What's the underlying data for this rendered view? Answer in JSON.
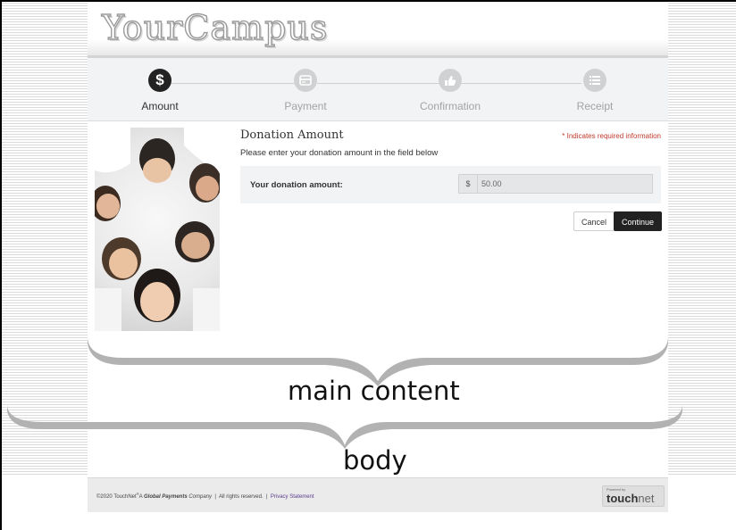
{
  "brand": {
    "logo_text": "YourCampus"
  },
  "steps": [
    {
      "label": "Amount",
      "icon": "dollar-icon",
      "symbol": "$"
    },
    {
      "label": "Payment",
      "icon": "card-icon"
    },
    {
      "label": "Confirmation",
      "icon": "thumbs-up-icon"
    },
    {
      "label": "Receipt",
      "icon": "list-icon"
    }
  ],
  "form": {
    "title": "Donation Amount",
    "required_note": "* Indicates required information",
    "instruction": "Please enter your donation amount in the field below",
    "amount_label": "Your donation amount:",
    "currency": "$",
    "amount_value": "50.00",
    "cancel_label": "Cancel",
    "continue_label": "Continue"
  },
  "annotations": {
    "main_content": "main content",
    "body": "body"
  },
  "footer": {
    "copyright": "©2020 TouchNet",
    "tagline_prefix": "A ",
    "tagline_bold": "Global Payments",
    "tagline_suffix": " Company",
    "rights": "All rights reserved.",
    "privacy": "Privacy Statement",
    "powered_by": "Powered by",
    "touchnet_bold": "touch",
    "touchnet_light": "net"
  },
  "colors": {
    "active_step": "#222222",
    "inactive_step": "#cfd1d3",
    "required": "#c0392b",
    "continue_button": "#222222"
  }
}
